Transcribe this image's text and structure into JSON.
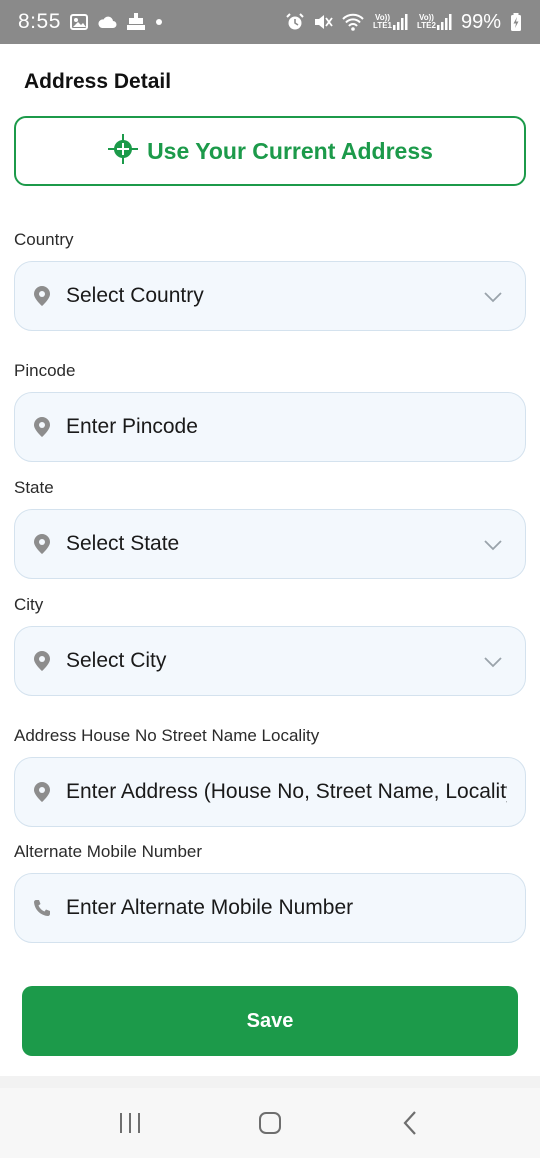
{
  "status_bar": {
    "time": "8:55",
    "battery": "99%",
    "left_icons": [
      "image-icon",
      "cloud-icon",
      "app-notification-icon",
      "dot-icon"
    ],
    "right_icons": [
      "alarm-icon",
      "mute-icon",
      "wifi-icon",
      "signal-lte1-icon",
      "signal-lte2-icon",
      "battery-charging-icon"
    ],
    "lte1_top": "Vo))",
    "lte1_bottom": "LTE1",
    "lte2_top": "Vo))",
    "lte2_bottom": "LTE2"
  },
  "page": {
    "title": "Address Detail",
    "current_address_button": "Use Your Current Address",
    "accent_color": "#1c9a4a"
  },
  "fields": [
    {
      "label": "Country",
      "value": "Select Country",
      "type": "select",
      "icon": "location-pin-icon"
    },
    {
      "label": "Pincode",
      "value": "Enter Pincode",
      "type": "input",
      "icon": "location-pin-icon"
    },
    {
      "label": "State",
      "value": "Select State",
      "type": "select",
      "icon": "location-pin-icon"
    },
    {
      "label": "City",
      "value": "Select City",
      "type": "select",
      "icon": "location-pin-icon"
    },
    {
      "label": "Address House No Street Name Locality",
      "value": "Enter Address (House No, Street Name, Locality)",
      "type": "input",
      "icon": "location-pin-icon"
    },
    {
      "label": "Alternate Mobile Number",
      "value": "Enter Alternate Mobile Number",
      "type": "input",
      "icon": "phone-icon"
    }
  ],
  "save_button": "Save",
  "nav_bar": {
    "buttons": [
      "recent-apps-icon",
      "home-icon",
      "back-icon"
    ]
  }
}
